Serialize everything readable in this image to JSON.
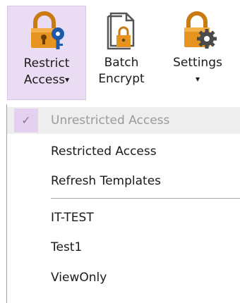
{
  "ribbon": {
    "buttons": [
      {
        "label_line1": "Restrict",
        "label_line2": "Access",
        "has_dropdown": true,
        "icon": "lock-key-icon"
      },
      {
        "label_line1": "Batch",
        "label_line2": "Encrypt",
        "has_dropdown": false,
        "icon": "document-lock-icon"
      },
      {
        "label_line1": "Settings",
        "label_line2": "",
        "has_dropdown": true,
        "icon": "lock-gear-icon"
      }
    ],
    "caret_glyph": "▾"
  },
  "menu": {
    "items": [
      {
        "label": "Unrestricted Access",
        "checked": true,
        "disabled": true
      },
      {
        "label": "Restricted Access",
        "checked": false,
        "disabled": false
      },
      {
        "label": "Refresh Templates",
        "checked": false,
        "disabled": false
      },
      {
        "label": "IT-TEST",
        "checked": false,
        "disabled": false
      },
      {
        "label": "Test1",
        "checked": false,
        "disabled": false
      },
      {
        "label": "ViewOnly",
        "checked": false,
        "disabled": false
      }
    ],
    "check_glyph": "✓"
  },
  "colors": {
    "selected_bg": "#eadcf2",
    "lock_orange": "#e69320",
    "key_blue": "#1f5aa8",
    "check_bg": "#e3d1ef",
    "disabled_text": "#9a9a9a"
  }
}
